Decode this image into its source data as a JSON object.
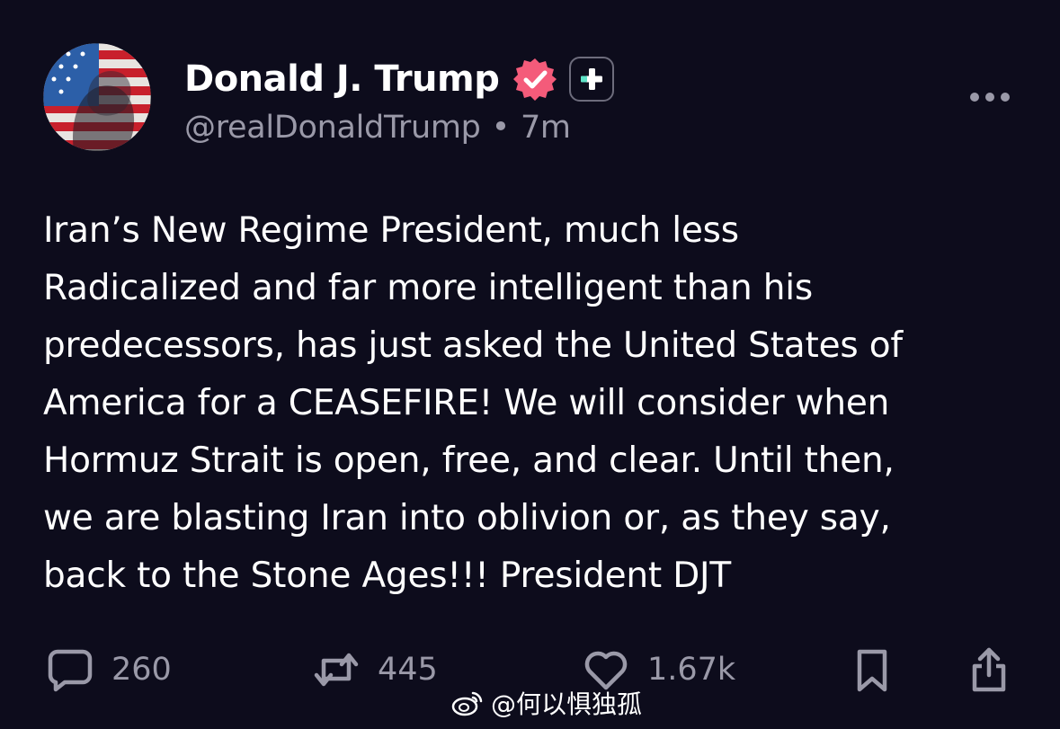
{
  "post": {
    "author": {
      "display_name": "Donald J. Trump",
      "handle": "@realDonaldTrump",
      "separator": "•",
      "time_ago": "7m",
      "avatar_icon": "flag-portrait-avatar",
      "verified_icon": "verified-badge-icon",
      "verified_color": "#f45b7a",
      "subscribe_icon": "plus-icon",
      "subscribe_accent": "#5ee3c8"
    },
    "text_lines": [
      "Iran’s New Regime President, much less",
      "Radicalized and far more intelligent than his",
      "predecessors, has just asked the United States of",
      "America for a CEASEFIRE! We will consider when",
      "Hormuz Strait is open, free, and clear. Until then,",
      "we are blasting Iran into oblivion or, as they say,",
      "back to the Stone Ages!!! President DJT"
    ],
    "actions": {
      "replies": {
        "icon": "comment-icon",
        "count": "260"
      },
      "reposts": {
        "icon": "repost-icon",
        "count": "445"
      },
      "likes": {
        "icon": "heart-icon",
        "count": "1.67k"
      },
      "bookmark": {
        "icon": "bookmark-icon"
      },
      "share": {
        "icon": "share-icon"
      }
    },
    "more_icon": "more-dots-icon"
  },
  "watermark": {
    "icon": "weibo-logo-icon",
    "text": "@何以惧独孤"
  },
  "colors": {
    "background": "#0d0c1c",
    "text_primary": "#ffffff",
    "text_secondary": "#9a99a8"
  }
}
